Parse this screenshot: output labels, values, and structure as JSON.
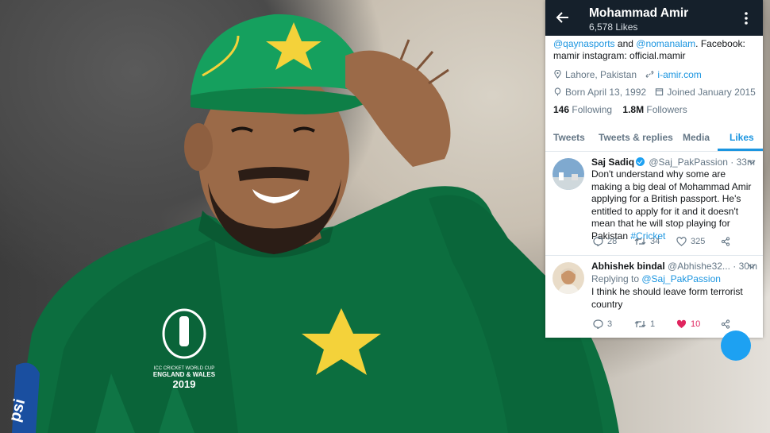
{
  "photo": {
    "jersey_text": "ICC CRICKET WORLD CUP",
    "jersey_text2": "ENGLAND & WALES",
    "jersey_year": "2019",
    "sponsor": "psi"
  },
  "header": {
    "name": "Mohammad Amir",
    "likes": "6,578 Likes"
  },
  "bio": {
    "mention1": "@qaynasports",
    "and": " and ",
    "mention2": "@nomanalam",
    "rest1": ". Facebook:",
    "line2": "mamir instagram: official.mamir"
  },
  "meta": {
    "location": "Lahore, Pakistan",
    "website": "i-amir.com",
    "born": "Born April 13, 1992",
    "joined": "Joined January 2015"
  },
  "stats": {
    "following_count": "146",
    "following_label": " Following",
    "followers_count": "1.8M",
    "followers_label": " Followers"
  },
  "tabs": [
    {
      "label": "Tweets"
    },
    {
      "label": "Tweets & replies"
    },
    {
      "label": "Media"
    },
    {
      "label": "Likes",
      "active": true
    }
  ],
  "tweets": [
    {
      "name": "Saj Sadiq",
      "handle": "@Saj_PakPassion · 33m",
      "text": "Don't understand why some are making a big deal of Mohammad Amir applying for a British passport. He's entitled to apply for it and it doesn't mean that he will stop playing for Pakistan ",
      "hashtag": "#Cricket",
      "replies": "28",
      "retweets": "34",
      "likes": "325"
    },
    {
      "name": "Abhishek bindal",
      "handle": "@Abhishe32... · 30m",
      "reply_prefix": "Replying to ",
      "reply_to": "@Saj_PakPassion",
      "text": "I think he should leave form terrorist country",
      "replies": "3",
      "retweets": "1",
      "likes": "10"
    }
  ],
  "colors": {
    "accent": "#1b95e0",
    "jersey": "#0f7a47",
    "header_bg": "#15202b",
    "like": "#e0245e"
  }
}
